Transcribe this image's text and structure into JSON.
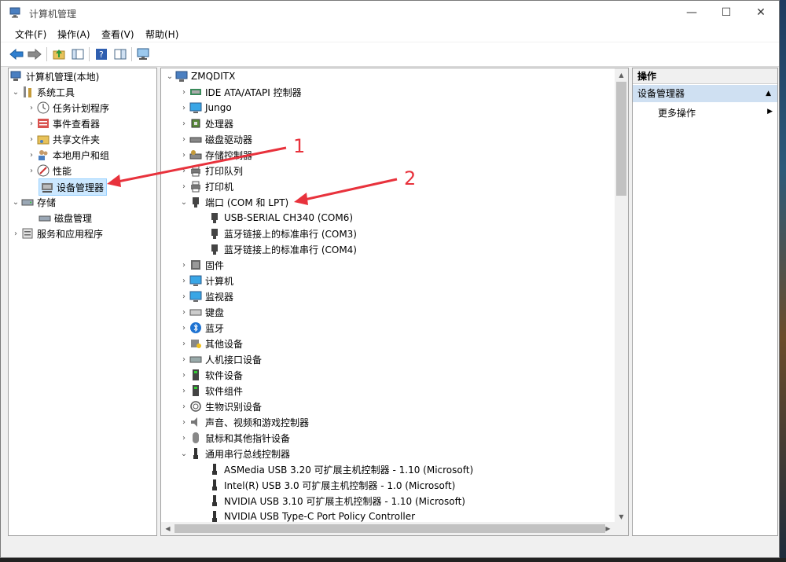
{
  "window": {
    "title": "计算机管理",
    "controls": {
      "minimize": "—",
      "maximize": "☐",
      "close": "✕"
    }
  },
  "menu": [
    {
      "label": "文件(F)"
    },
    {
      "label": "操作(A)"
    },
    {
      "label": "查看(V)"
    },
    {
      "label": "帮助(H)"
    }
  ],
  "left_tree": [
    {
      "label": "计算机管理(本地)",
      "icon": "computer-management-icon"
    },
    {
      "label": "系统工具",
      "icon": "tools-icon"
    },
    {
      "label": "任务计划程序",
      "icon": "clock-icon"
    },
    {
      "label": "事件查看器",
      "icon": "event-viewer-icon"
    },
    {
      "label": "共享文件夹",
      "icon": "shared-folder-icon"
    },
    {
      "label": "本地用户和组",
      "icon": "users-icon"
    },
    {
      "label": "性能",
      "icon": "performance-icon"
    },
    {
      "label": "设备管理器",
      "icon": "device-manager-icon"
    },
    {
      "label": "存储",
      "icon": "storage-icon"
    },
    {
      "label": "磁盘管理",
      "icon": "disk-management-icon"
    },
    {
      "label": "服务和应用程序",
      "icon": "services-icon"
    }
  ],
  "device_tree": [
    {
      "label": "ZMQDITX"
    },
    {
      "label": "IDE ATA/ATAPI 控制器"
    },
    {
      "label": "Jungo"
    },
    {
      "label": "处理器"
    },
    {
      "label": "磁盘驱动器"
    },
    {
      "label": "存储控制器"
    },
    {
      "label": "打印队列"
    },
    {
      "label": "打印机"
    },
    {
      "label": "端口 (COM 和 LPT)"
    },
    {
      "label": "USB-SERIAL CH340 (COM6)"
    },
    {
      "label": "蓝牙链接上的标准串行 (COM3)"
    },
    {
      "label": "蓝牙链接上的标准串行 (COM4)"
    },
    {
      "label": "固件"
    },
    {
      "label": "计算机"
    },
    {
      "label": "监视器"
    },
    {
      "label": "键盘"
    },
    {
      "label": "蓝牙"
    },
    {
      "label": "其他设备"
    },
    {
      "label": "人机接口设备"
    },
    {
      "label": "软件设备"
    },
    {
      "label": "软件组件"
    },
    {
      "label": "生物识别设备"
    },
    {
      "label": "声音、视频和游戏控制器"
    },
    {
      "label": "鼠标和其他指针设备"
    },
    {
      "label": "通用串行总线控制器"
    },
    {
      "label": "ASMedia USB 3.20 可扩展主机控制器 - 1.10 (Microsoft)"
    },
    {
      "label": "Intel(R) USB 3.0 可扩展主机控制器 - 1.0 (Microsoft)"
    },
    {
      "label": "NVIDIA USB 3.10 可扩展主机控制器 - 1.10 (Microsoft)"
    },
    {
      "label": "NVIDIA USB Type-C Port Policy Controller"
    }
  ],
  "actions": {
    "header": "操作",
    "section": "设备管理器",
    "more": "更多操作"
  },
  "annotations": [
    {
      "label": "1",
      "color": "#e8323c"
    },
    {
      "label": "2",
      "color": "#e8323c"
    }
  ],
  "colors": {
    "selection": "#cce8ff",
    "accent": "#0078d7",
    "arrow": "#e8323c"
  }
}
